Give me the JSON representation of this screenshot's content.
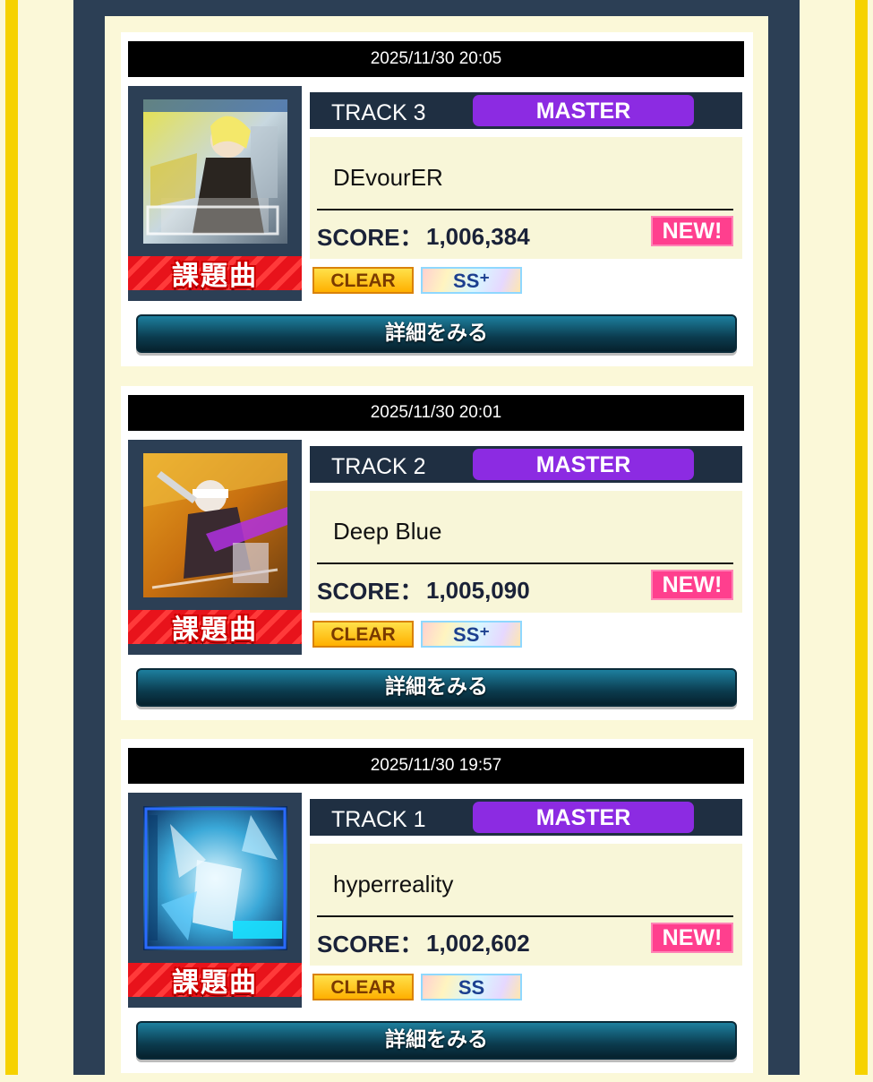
{
  "colors": {
    "background": "#fbf8d8",
    "frame": "#2c3f55",
    "master": "#8c2be2",
    "new_badge": "#ff3f8e",
    "challenge_ribbon": "#e8131b"
  },
  "records": [
    {
      "datetime": "2025/11/30 20:05",
      "track": "TRACK 3",
      "difficulty": "MASTER",
      "title": "DEvourER",
      "score_label": "SCORE：",
      "score": "1,006,384",
      "new_badge": "NEW!",
      "challenge_label": "課題曲",
      "clear_lamp": "CLEAR",
      "rank": "SS⁺",
      "detail_button": "詳細をみる",
      "jacket": "DEvourER-jacket-art"
    },
    {
      "datetime": "2025/11/30 20:01",
      "track": "TRACK 2",
      "difficulty": "MASTER",
      "title": "Deep Blue",
      "score_label": "SCORE：",
      "score": "1,005,090",
      "new_badge": "NEW!",
      "challenge_label": "課題曲",
      "clear_lamp": "CLEAR",
      "rank": "SS⁺",
      "detail_button": "詳細をみる",
      "jacket": "Deep-Blue-jacket-art"
    },
    {
      "datetime": "2025/11/30 19:57",
      "track": "TRACK 1",
      "difficulty": "MASTER",
      "title": "hyperreality",
      "score_label": "SCORE：",
      "score": "1,002,602",
      "new_badge": "NEW!",
      "challenge_label": "課題曲",
      "clear_lamp": "CLEAR",
      "rank": "SS",
      "detail_button": "詳細をみる",
      "jacket": "hyperreality-jacket-art"
    }
  ]
}
